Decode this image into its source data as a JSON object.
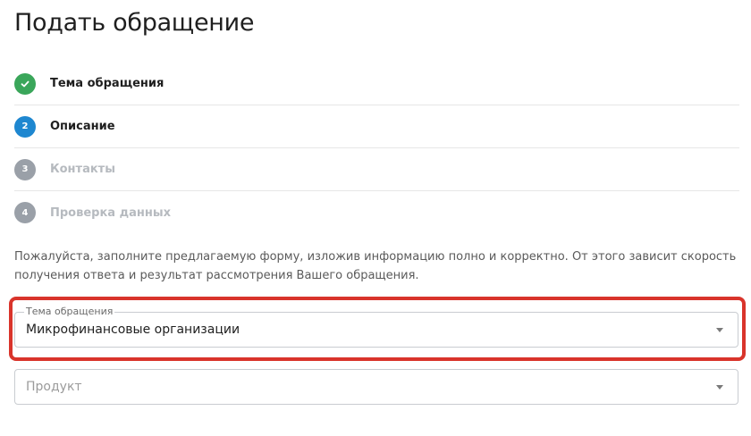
{
  "page": {
    "title": "Подать обращение"
  },
  "steps": [
    {
      "number": "",
      "label": "Тема обращения",
      "state": "done",
      "icon": "check-icon"
    },
    {
      "number": "2",
      "label": "Описание",
      "state": "active"
    },
    {
      "number": "3",
      "label": "Контакты",
      "state": "todo"
    },
    {
      "number": "4",
      "label": "Проверка данных",
      "state": "todo"
    }
  ],
  "intro_text": "Пожалуйста, заполните предлагаемую форму, изложив информацию полно и корректно. От этого зависит скорость получения ответа и результат рассмотрения Вашего обращения.",
  "form": {
    "topic": {
      "label": "Тема обращения",
      "value": "Микрофинансовые организации"
    },
    "product": {
      "placeholder": "Продукт",
      "value": ""
    }
  },
  "colors": {
    "done": "#3aa65a",
    "active": "#1e87d0",
    "todo": "#9aa0a8",
    "highlight": "#d9342b"
  }
}
